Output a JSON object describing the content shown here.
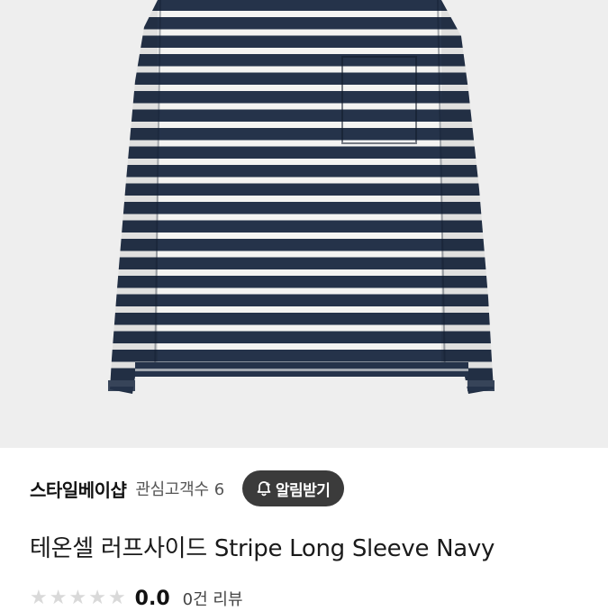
{
  "product": {
    "image_alt": "striped long sleeve navy shirt",
    "stripe_colors": {
      "navy": "#25334a",
      "white": "#f4f4f2"
    },
    "background": "#eeeeee"
  },
  "store": {
    "name": "스타일베이샵",
    "followers_label": "관심고객수",
    "followers_count": "6",
    "alert_button_label": "알림받기"
  },
  "title": "테온셀 러프사이드 Stripe Long Sleeve Navy",
  "rating": {
    "stars": 0,
    "score": "0.0",
    "review_count_label": "0건 리뷰"
  }
}
